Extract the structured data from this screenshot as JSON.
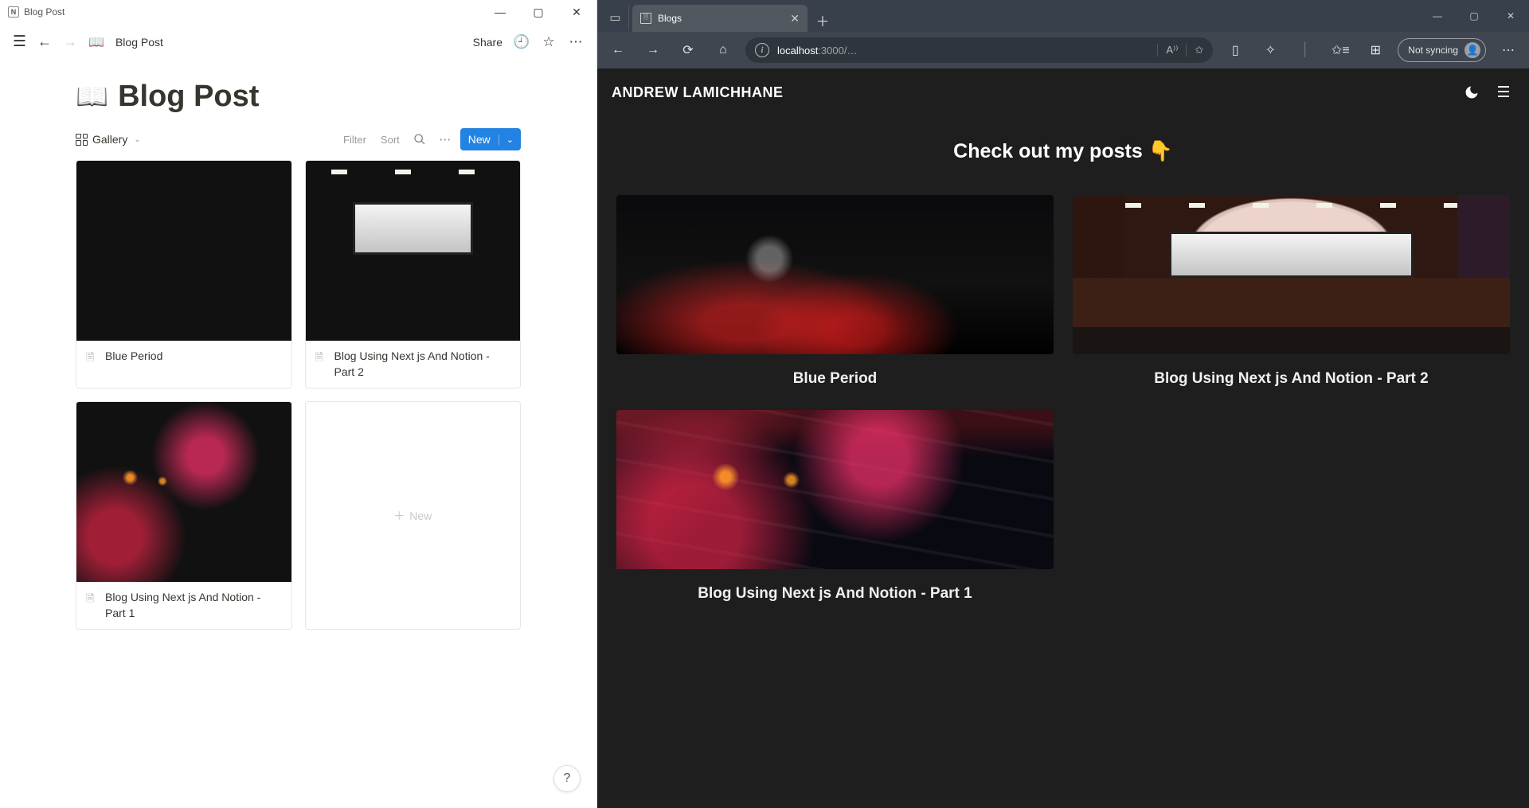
{
  "notion": {
    "window_title": "Blog Post",
    "breadcrumb": "Blog Post",
    "topbar": {
      "share_label": "Share"
    },
    "page_title": "Blog Post",
    "db": {
      "view_label": "Gallery",
      "filter_label": "Filter",
      "sort_label": "Sort",
      "new_label": "New"
    },
    "cards": [
      {
        "title": "Blue Period",
        "thumb": "railway"
      },
      {
        "title": "Blog Using Next js And Notion  - Part 2",
        "thumb": "cinema"
      },
      {
        "title": "Blog Using Next js And Notion - Part 1",
        "thumb": "keyboard"
      }
    ],
    "new_card_label": "New",
    "help_label": "?"
  },
  "edge": {
    "tab_title": "Blogs",
    "url_host": "localhost",
    "url_rest": ":3000/…",
    "read_aloud_label": "A⁾⁾",
    "sync_label": "Not syncing",
    "site": {
      "logo": "ANDREW LAMICHHANE",
      "hero": "Check out my posts",
      "hero_emoji": "👇",
      "posts": [
        {
          "title": "Blue Period",
          "thumb": "railway"
        },
        {
          "title": "Blog Using Next js And Notion - Part 2",
          "thumb": "cinema"
        },
        {
          "title": "Blog Using Next js And Notion - Part 1",
          "thumb": "keyboard"
        }
      ]
    }
  }
}
